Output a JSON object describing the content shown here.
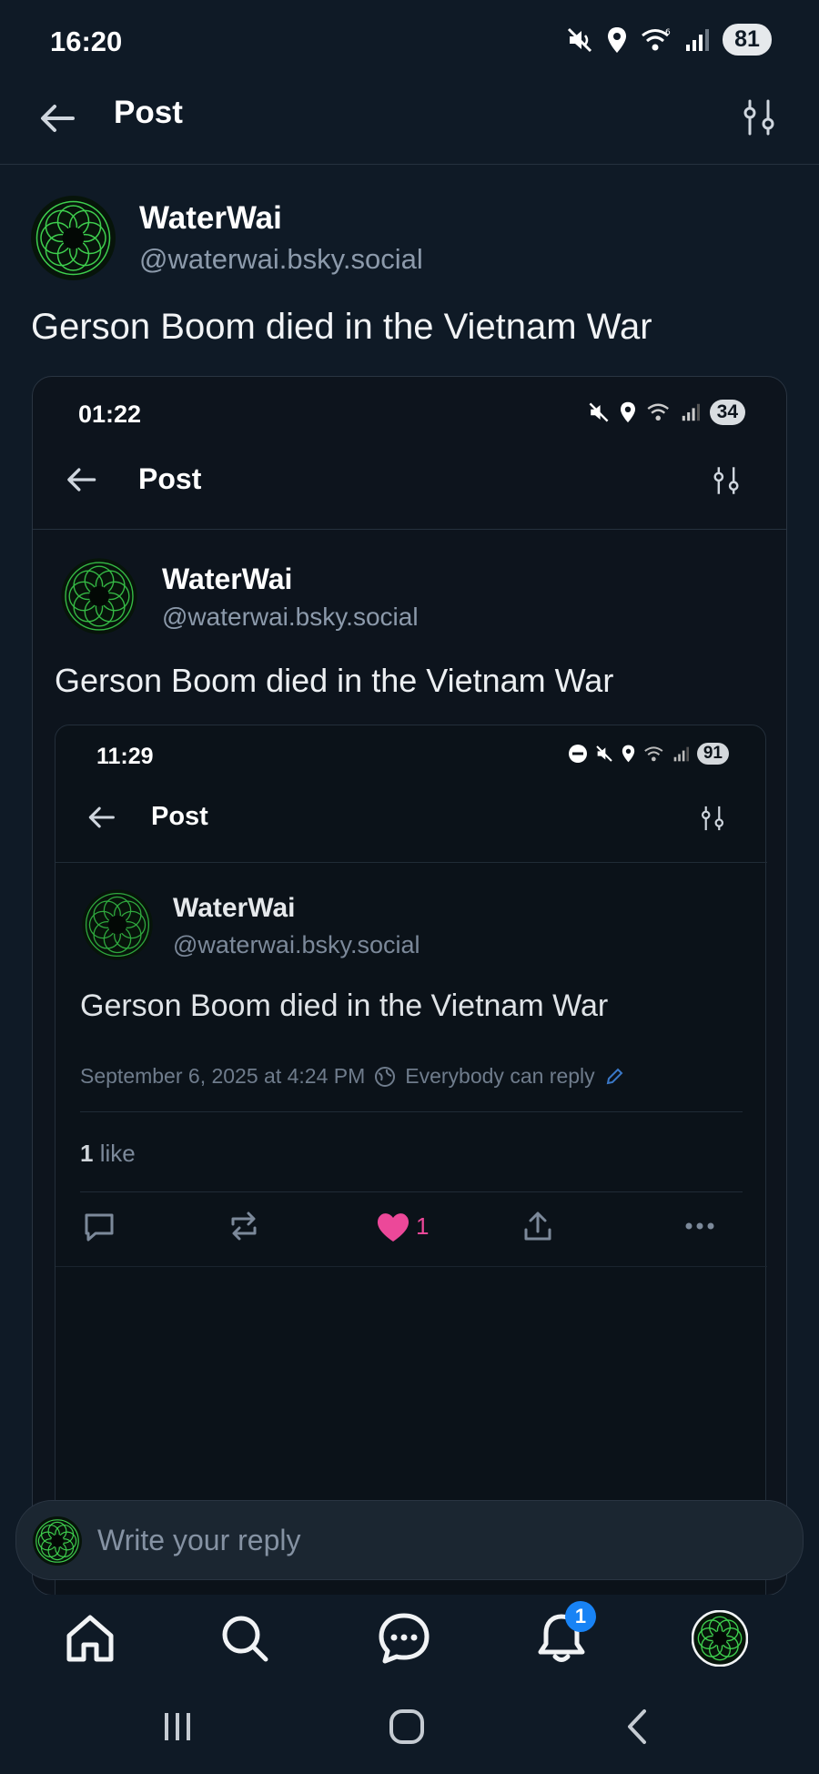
{
  "status": {
    "time": "16:20",
    "battery": "81"
  },
  "header": {
    "title": "Post"
  },
  "post": {
    "author_name": "WaterWai",
    "author_handle": "@waterwai.bsky.social",
    "text": "Gerson Boom died in the Vietnam War"
  },
  "embed": {
    "status": {
      "time": "01:22",
      "battery": "34"
    },
    "header_title": "Post",
    "author_name": "WaterWai",
    "author_handle": "@waterwai.bsky.social",
    "text": "Gerson Boom died in the Vietnam War",
    "inner": {
      "status": {
        "time": "11:29",
        "battery": "91"
      },
      "header_title": "Post",
      "author_name": "WaterWai",
      "author_handle": "@waterwai.bsky.social",
      "text": "Gerson Boom died in the Vietnam War",
      "meta_date": "September 6, 2025 at 4:24 PM",
      "meta_reply": "Everybody can reply",
      "likes_count": "1",
      "likes_label": "like",
      "like_action_count": "1"
    }
  },
  "reply": {
    "placeholder": "Write your reply"
  },
  "tabbar": {
    "notifications_badge": "1"
  },
  "colors": {
    "background": "#0f1a26",
    "accent": "#1883f5",
    "like": "#ec4899",
    "avatar_ring": "#3ecf4e"
  }
}
